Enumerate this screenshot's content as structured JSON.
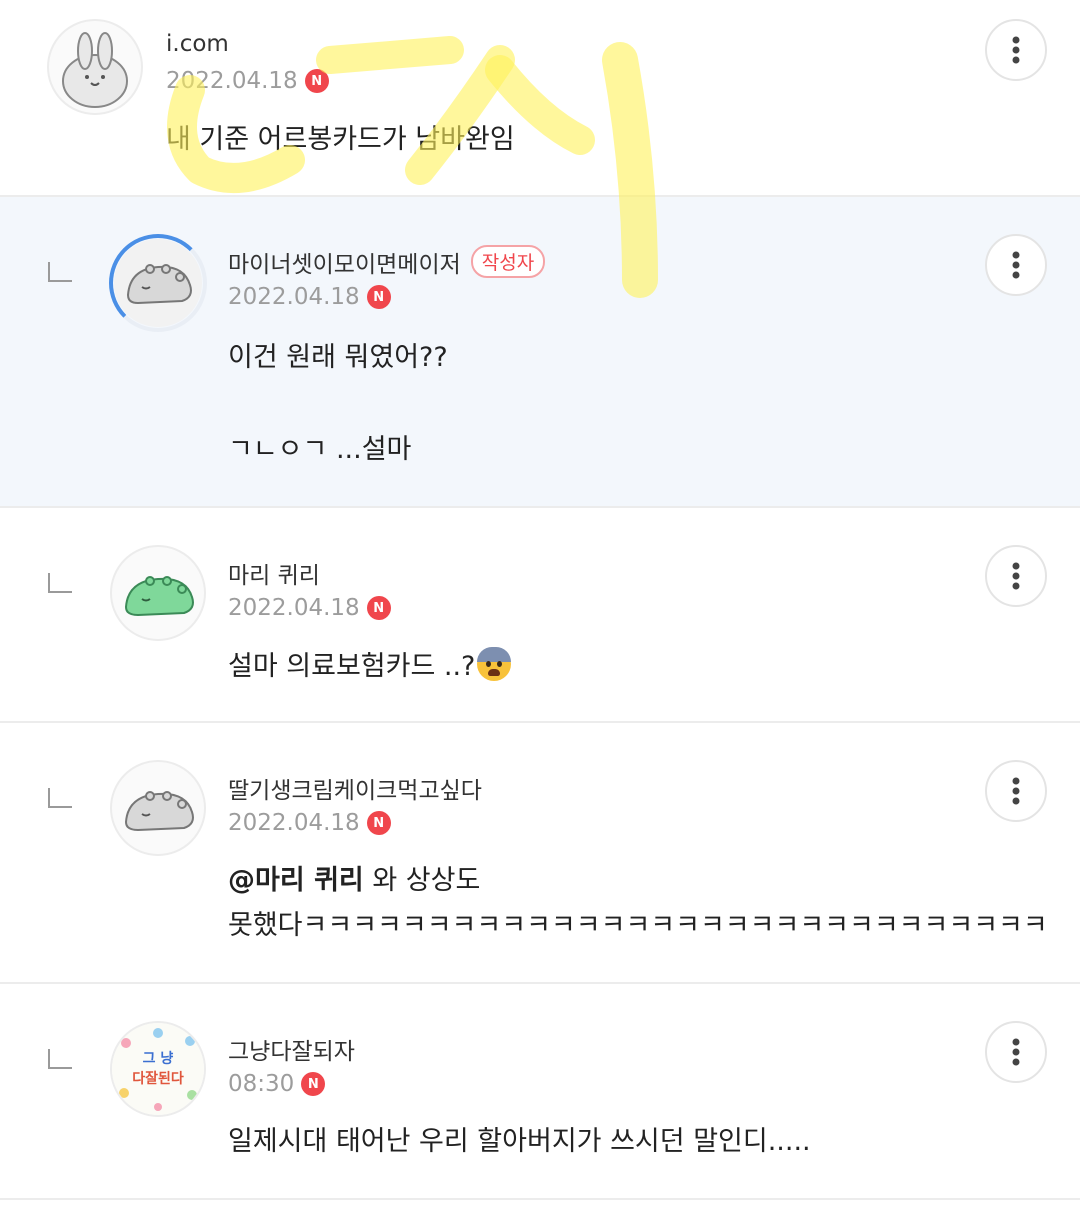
{
  "comments": [
    {
      "nickname": "i.com",
      "date": "2022.04.18",
      "new_badge": "N",
      "lines": [
        "내 기준 어르봉카드가 남바완임"
      ]
    },
    {
      "nickname": "마이너셋이모이면메이저",
      "author_badge": "작성자",
      "date": "2022.04.18",
      "new_badge": "N",
      "lines": [
        "이건 원래 뭐였어??",
        "ㄱㄴㅇㄱ ...설마"
      ]
    },
    {
      "nickname": "마리 퀴리",
      "date": "2022.04.18",
      "new_badge": "N",
      "lines": [
        "설마 의료보험카드 ..?"
      ],
      "emoji": "anxious-face-emoji"
    },
    {
      "nickname": "딸기생크림케이크먹고싶다",
      "date": "2022.04.18",
      "new_badge": "N",
      "mention": "@마리 퀴리",
      "lines": [
        " 와 상상도",
        "못했다ㅋㅋㅋㅋㅋㅋㅋㅋㅋㅋㅋㅋㅋㅋㅋㅋㅋㅋㅋㅋㅋㅋㅋㅋㅋㅋㅋㅋㅋㅋ"
      ]
    },
    {
      "nickname": "그냥다잘되자",
      "date": "08:30",
      "new_badge": "N",
      "lines": [
        "일제시대 태어난 우리 할아버지가 쓰시던 말인디....."
      ],
      "avatar_text": [
        "그 냥",
        "다잘된다"
      ]
    }
  ],
  "colors": {
    "author_highlight": "#f3f7fc",
    "new_badge": "#f0464c",
    "marker_overlay": "#fff25a"
  },
  "icons": [
    "more-vertical-icon",
    "reply-arrow-icon",
    "new-badge-icon"
  ]
}
